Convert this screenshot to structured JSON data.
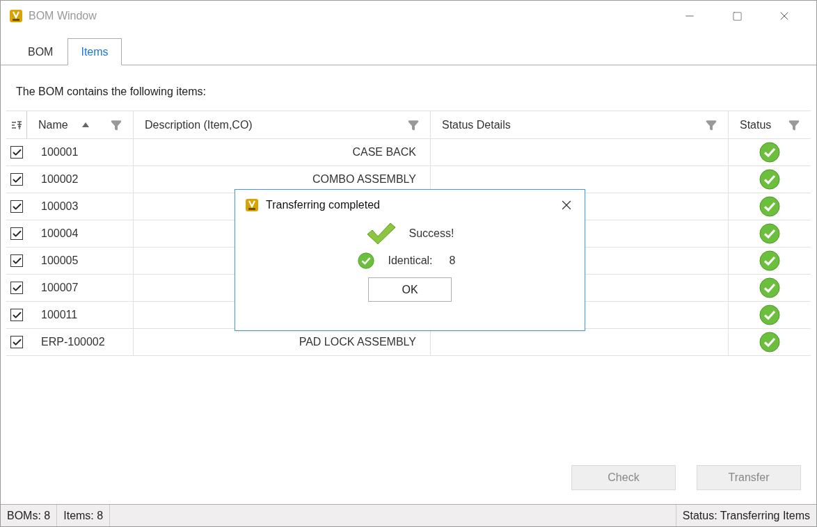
{
  "window": {
    "title": "BOM Window"
  },
  "tabs": [
    {
      "label": "BOM",
      "selected": false
    },
    {
      "label": "Items",
      "selected": true
    }
  ],
  "intro": "The BOM contains the following items:",
  "table": {
    "columns": [
      {
        "label": "Name",
        "sorted": true,
        "filter": true
      },
      {
        "label": "Description (Item,CO)",
        "sorted": false,
        "filter": true
      },
      {
        "label": "Status Details",
        "sorted": false,
        "filter": true
      },
      {
        "label": "Status",
        "sorted": false,
        "filter": true
      }
    ],
    "rows": [
      {
        "checked": true,
        "name": "100001",
        "description": "CASE BACK",
        "kind": "success"
      },
      {
        "checked": true,
        "name": "100002",
        "description": "COMBO ASSEMBLY",
        "kind": "success"
      },
      {
        "checked": true,
        "name": "100003",
        "kind": "success"
      },
      {
        "checked": true,
        "name": "100004",
        "kind": "success"
      },
      {
        "checked": true,
        "name": "100005",
        "kind": "success"
      },
      {
        "checked": true,
        "name": "100007",
        "kind": "success"
      },
      {
        "checked": true,
        "name": "100011",
        "kind": "success"
      },
      {
        "checked": true,
        "name": "ERP-100002",
        "description": "PAD LOCK ASSEMBLY",
        "kind": "success"
      }
    ]
  },
  "buttons": [
    {
      "label": "Check",
      "disabled": true
    },
    {
      "label": "Transfer",
      "disabled": true
    }
  ],
  "status_bar": {
    "boms": "BOMs: 8",
    "items": "Items: 8",
    "status": "Status: Transferring Items"
  },
  "dialog": {
    "title": "Transferring completed",
    "message": "Success!",
    "result_label": "Identical:",
    "result_count": "8",
    "ok": "OK"
  }
}
